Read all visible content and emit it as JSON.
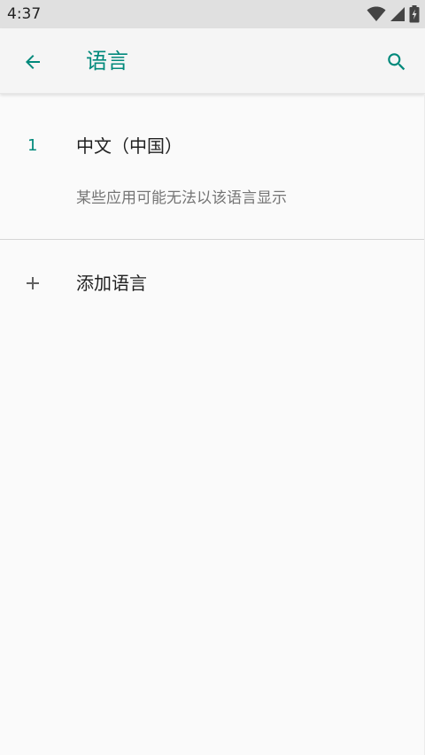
{
  "status_bar": {
    "time": "4:37",
    "icons": [
      "wifi-icon",
      "signal-icon",
      "battery-charging-icon"
    ]
  },
  "app_bar": {
    "back_icon": "arrow-left-icon",
    "title": "语言",
    "search_icon": "search-icon",
    "accent_color": "#00897b"
  },
  "languages": [
    {
      "index": "1",
      "name": "中文（中国）",
      "note": "某些应用可能无法以该语言显示"
    }
  ],
  "add_language": {
    "icon": "plus-icon",
    "label": "添加语言"
  }
}
